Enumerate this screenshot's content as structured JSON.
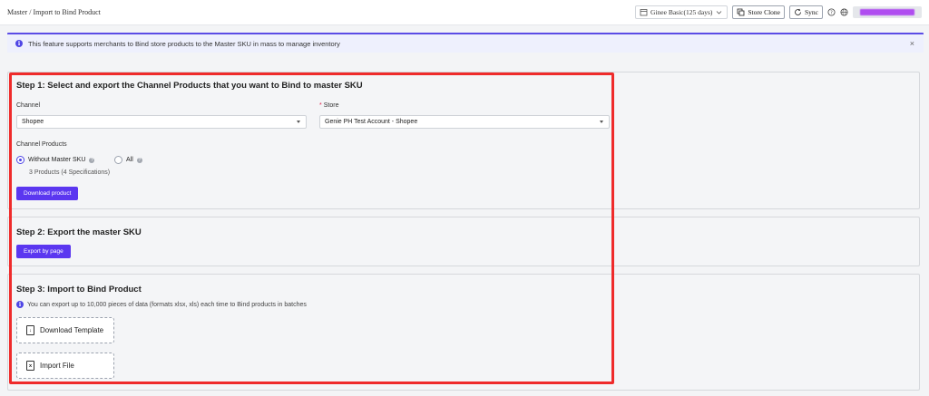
{
  "header": {
    "breadcrumb": "Master / Import to Bind Product",
    "plan": "Ginee Basic(125 days)",
    "store_clone_label": "Store Clone",
    "sync_label": "Sync"
  },
  "notice": {
    "text": "This feature supports merchants to Bind store products to the Master SKU in mass to manage inventory",
    "close": "×"
  },
  "step1": {
    "title": "Step 1: Select and export the Channel Products that you want to Bind to master SKU",
    "channel_label": "Channel",
    "channel_value": "Shopee",
    "store_required": "*",
    "store_label": "Store",
    "store_value": "Genie PH Test Account - Shopee",
    "products_label": "Channel Products",
    "option_without": "Without Master SKU",
    "option_all": "All",
    "count_text": "3 Products (4 Specifications)",
    "download_label": "Download product"
  },
  "step2": {
    "title": "Step 2: Export the master SKU",
    "export_label": "Export by page"
  },
  "step3": {
    "title": "Step 3: Import to Bind Product",
    "info": "You can export up to 10,000 pieces of data (formats xlsx, xls) each time to Bind products in batches",
    "template_label": "Download Template",
    "import_label": "Import File"
  },
  "icons": {
    "info": "i",
    "help": "?",
    "file_download": "↓",
    "file_excel": "x"
  },
  "colors": {
    "primary": "#5b37f0",
    "highlight": "#ef2b2b",
    "notice_bg": "#eef0fd"
  }
}
